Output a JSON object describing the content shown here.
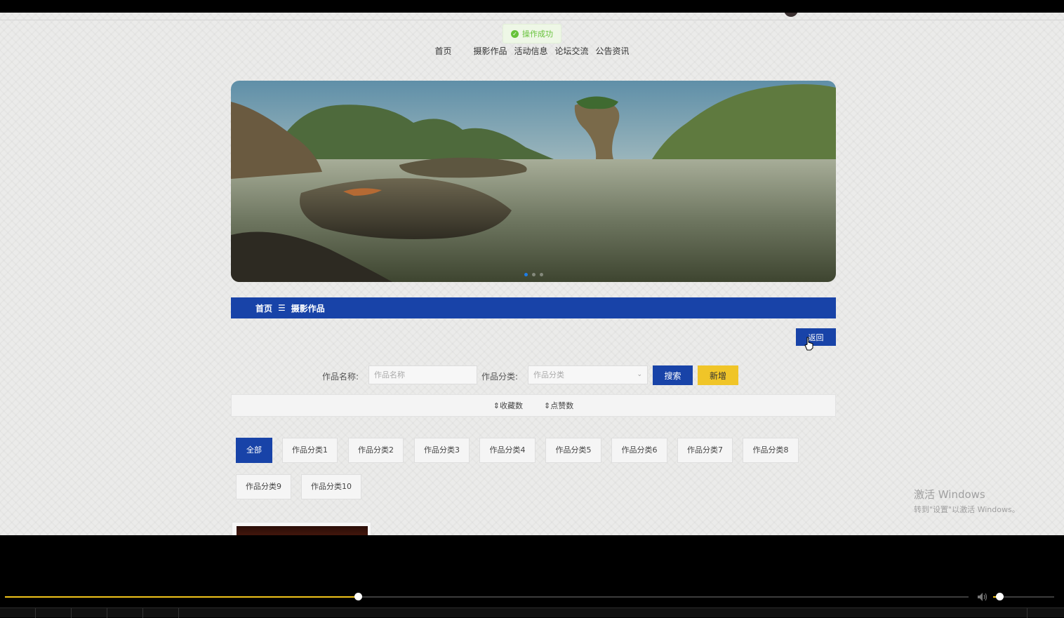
{
  "toast": {
    "message": "操作成功"
  },
  "nav": {
    "items": [
      "首页",
      "摄影作品",
      "活动信息",
      "论坛交流",
      "公告资讯"
    ]
  },
  "banner": {
    "slide_count": 3,
    "active_slide": 1
  },
  "breadcrumb": {
    "home": "首页",
    "separator": "☰",
    "current": "摄影作品"
  },
  "back_button": {
    "label": "返回"
  },
  "search": {
    "name_label": "作品名称:",
    "name_placeholder": "作品名称",
    "category_label": "作品分类:",
    "category_placeholder": "作品分类",
    "search_button": "搜索",
    "add_button": "新增"
  },
  "sort": {
    "items": [
      "收藏数",
      "点赞数"
    ]
  },
  "categories": {
    "active_index": 0,
    "items": [
      "全部",
      "作品分类1",
      "作品分类2",
      "作品分类3",
      "作品分类4",
      "作品分类5",
      "作品分类6",
      "作品分类7",
      "作品分类8",
      "作品分类9",
      "作品分类10"
    ]
  },
  "watermark": {
    "title": "激活 Windows",
    "subtitle": "转到\"设置\"以激活 Windows。"
  },
  "player": {
    "progress": 0.366,
    "volume": 0.1
  },
  "colors": {
    "primary": "#1843a8",
    "accent": "#f0c528",
    "success": "#67c23a",
    "progress": "#f0c41a"
  }
}
